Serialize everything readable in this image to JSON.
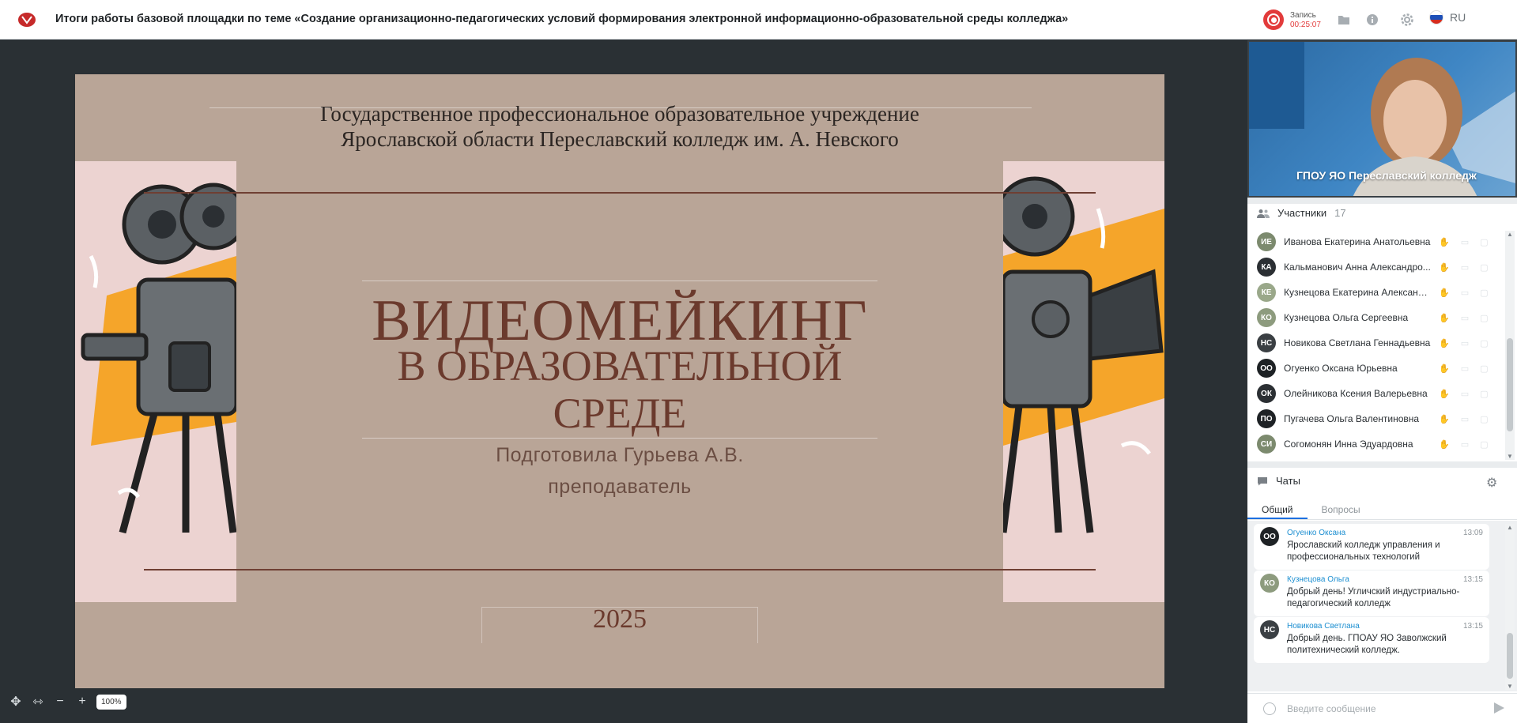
{
  "header": {
    "title": "Итоги работы базовой площадки по теме «Создание организационно-педагогических условий формирования электронной информационно-образовательной среды колледжа»",
    "rec_label": "Запись",
    "rec_time": "00:25:07",
    "lang": "RU"
  },
  "slide": {
    "institution_line1": "Государственное профессиональное образовательное учреждение",
    "institution_line2": "Ярославской области Переславский колледж им. А. Невского",
    "title_line1": "ВИДЕОМЕЙКИНГ",
    "title_line2": "В ОБРАЗОВАТЕЛЬНОЙ",
    "title_line3": "СРЕДЕ",
    "author": "Подготовила Гурьева А.В.",
    "role": "преподаватель",
    "year": "2025"
  },
  "zoom": {
    "value": "100%",
    "minus": "−",
    "plus": "+"
  },
  "video": {
    "name": "ГПОУ ЯО Переславский колледж"
  },
  "participants": {
    "label": "Участники",
    "count": "17",
    "items": [
      {
        "initials": "ИЕ",
        "name": "Иванова Екатерина Анатольевна",
        "color": "#7c8a6e"
      },
      {
        "initials": "КА",
        "name": "Кальманович Анна Александро...",
        "color": "#2b2f33"
      },
      {
        "initials": "КЕ",
        "name": "Кузнецова Екатерина Александ...",
        "color": "#9aa88a"
      },
      {
        "initials": "КО",
        "name": "Кузнецова Ольга Сергеевна",
        "color": "#8d9b7e"
      },
      {
        "initials": "НС",
        "name": "Новикова Светлана Геннадьевна",
        "color": "#3a3f43"
      },
      {
        "initials": "ОО",
        "name": "Огуенко Оксана Юрьевна",
        "color": "#1e2225"
      },
      {
        "initials": "ОК",
        "name": "Олейникова Ксения Валерьевна",
        "color": "#2b2f33"
      },
      {
        "initials": "ПО",
        "name": "Пугачева Ольга Валентиновна",
        "color": "#1e2225"
      },
      {
        "initials": "СИ",
        "name": "Согомонян Инна Эдуардовна",
        "color": "#7c8a6e"
      }
    ]
  },
  "chat": {
    "label": "Чаты",
    "tabs": [
      "Общий",
      "Вопросы"
    ],
    "messages": [
      {
        "initials": "ОО",
        "name": "Огуенко Оксана",
        "time": "13:09",
        "text": "Ярославский колледж управления и профессиональных технологий",
        "color": "#1e2225"
      },
      {
        "initials": "КО",
        "name": "Кузнецова Ольга",
        "time": "13:15",
        "text": "Добрый день! Угличский индустриально-педагогический колледж",
        "color": "#8d9b7e"
      },
      {
        "initials": "НС",
        "name": "Новикова Светлана",
        "time": "13:15",
        "text": "Добрый день. ГПОАУ ЯО Заволжский политехнический колледж.",
        "color": "#3a3f43"
      }
    ],
    "input_placeholder": "Введите сообщение"
  }
}
